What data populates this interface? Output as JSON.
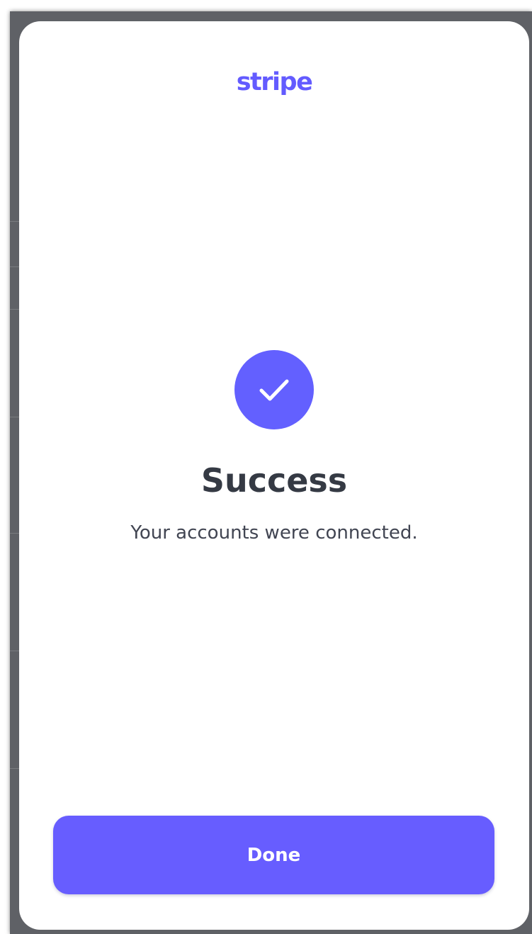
{
  "modal": {
    "logo_text": "stripe",
    "status_icon": "checkmark-icon",
    "title": "Success",
    "message": "Your accounts were connected.",
    "done_label": "Done"
  },
  "colors": {
    "brand": "#635bff",
    "button": "#675dff",
    "title_text": "#353a44",
    "body_text": "#414552"
  }
}
